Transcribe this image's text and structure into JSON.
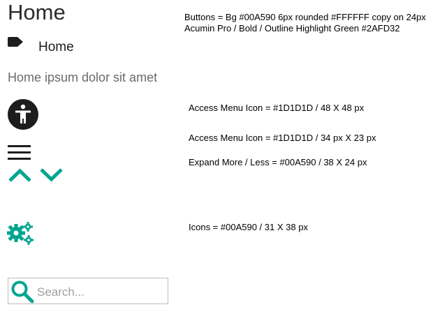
{
  "page_title": "Home",
  "label_item": {
    "icon": "label-icon",
    "text": "Home"
  },
  "body_text": "Home ipsum dolor sit amet",
  "icons": {
    "accessibility": "accessibility-icon",
    "menu": "hamburger-menu-icon",
    "expand_less": "chevron-up-icon",
    "expand_more": "chevron-down-icon",
    "settings": "gears-icon",
    "search": "search-icon"
  },
  "search": {
    "placeholder": "Search..."
  },
  "colors": {
    "accent": "#00A590",
    "dark_icon": "#1D1D1D",
    "text_gray": "#6A6A6A",
    "highlight_green": "#2AFD32",
    "button_text": "#FFFFFF"
  },
  "spec_notes": {
    "buttons": "Buttons = Bg #00A590 6px rounded #FFFFFF copy on 24px Acumin Pro / Bold / Outline Highlight Green #2AFD32",
    "access_menu_48": "Access Menu Icon = #1D1D1D / 48 X 48 px",
    "access_menu_34": "Access Menu Icon = #1D1D1D / 34 px X 23 px",
    "expand": "Expand More / Less = #00A590 / 38 X 24 px",
    "icons": "Icons = #00A590 / 31 X 38 px"
  }
}
